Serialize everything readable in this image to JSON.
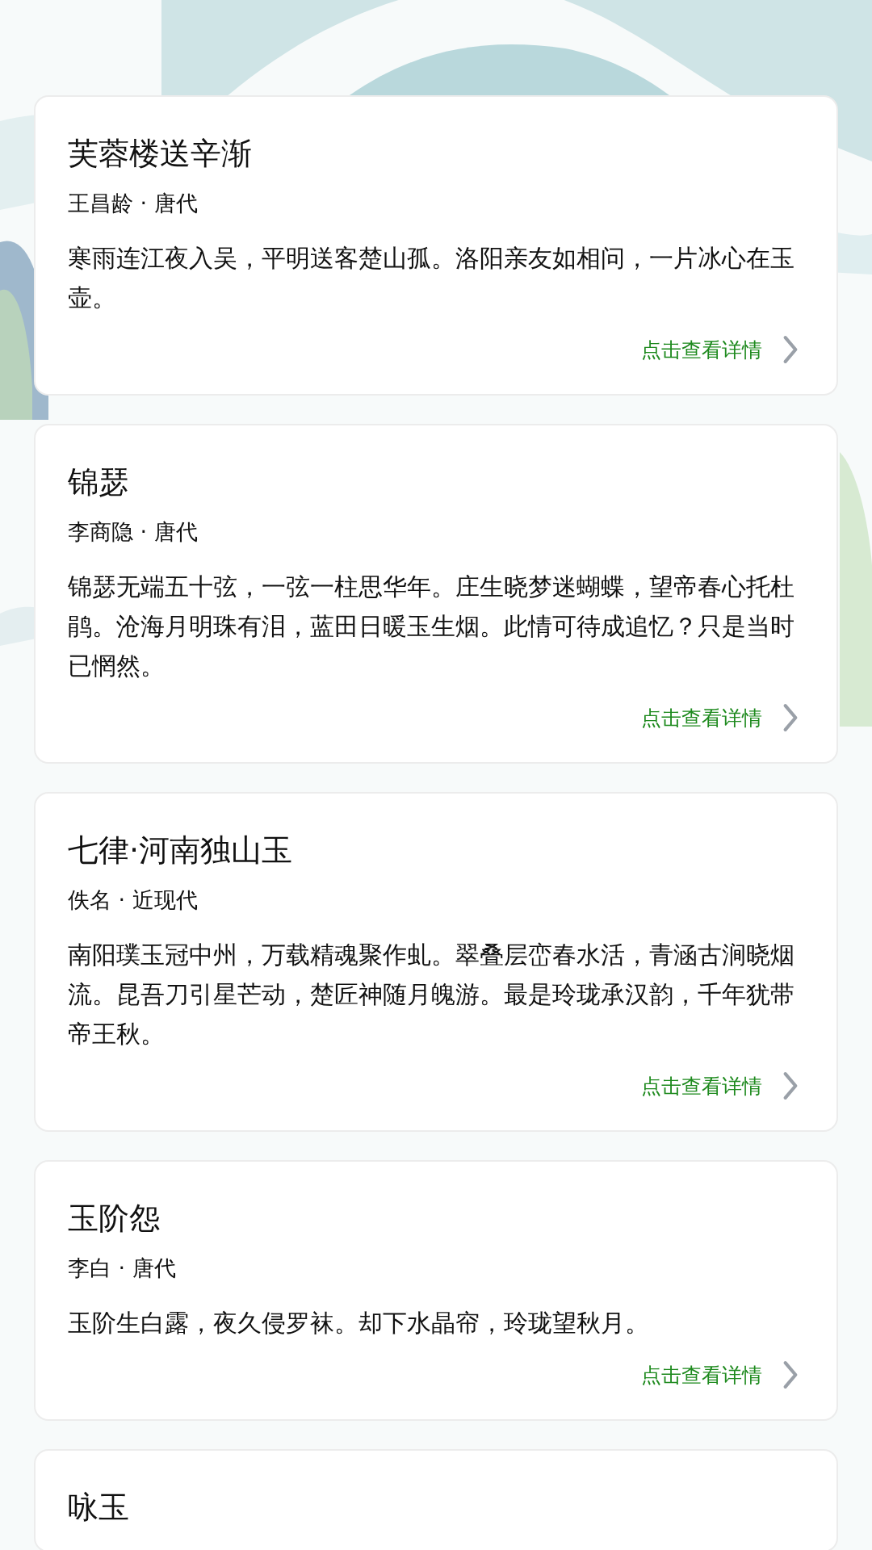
{
  "poems": [
    {
      "title": "芙蓉楼送辛渐",
      "meta": "王昌龄 · 唐代",
      "text": "寒雨连江夜入吴，平明送客楚山孤。洛阳亲友如相问，一片冰心在玉壶。",
      "link": "点击查看详情"
    },
    {
      "title": "锦瑟",
      "meta": "李商隐 · 唐代",
      "text": "锦瑟无端五十弦，一弦一柱思华年。庄生晓梦迷蝴蝶，望帝春心托杜鹃。沧海月明珠有泪，蓝田日暖玉生烟。此情可待成追忆？只是当时已惘然。",
      "link": "点击查看详情"
    },
    {
      "title": "七律·河南独山玉",
      "meta": "佚名 · 近现代",
      "text": "南阳璞玉冠中州，万载精魂聚作虬。翠叠层峦春水活，青涵古涧晓烟流。昆吾刀引星芒动，楚匠神随月魄游。最是玲珑承汉韵，千年犹带帝王秋。",
      "link": "点击查看详情"
    },
    {
      "title": "玉阶怨",
      "meta": "李白 · 唐代",
      "text": "玉阶生白露，夜久侵罗袜。却下水晶帘，玲珑望秋月。",
      "link": "点击查看详情"
    },
    {
      "title": "咏玉"
    }
  ]
}
